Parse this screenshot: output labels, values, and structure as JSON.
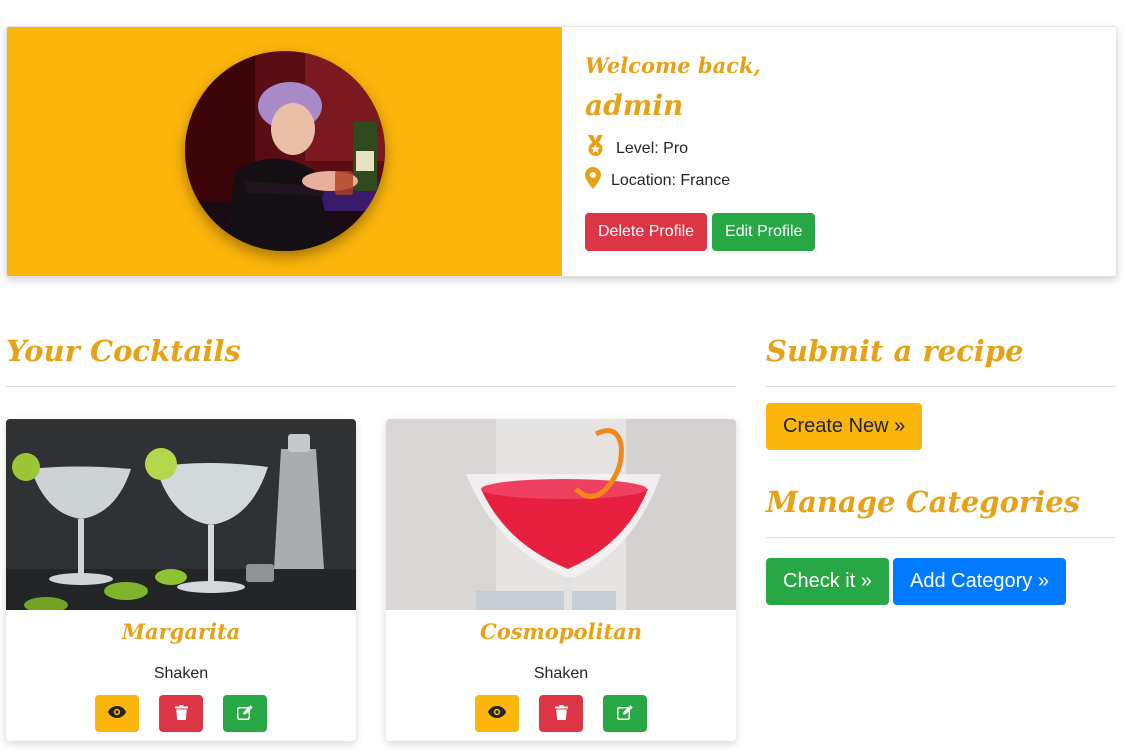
{
  "profile": {
    "welcome": "Welcome back,",
    "username": "admin",
    "level": "Level: Pro",
    "location": "Location: France",
    "delete_label": "Delete Profile",
    "edit_label": "Edit Profile"
  },
  "cocktails": {
    "title": "Your Cocktails",
    "items": [
      {
        "name": "Margarita",
        "method": "Shaken"
      },
      {
        "name": "Cosmopolitan",
        "method": "Shaken"
      }
    ]
  },
  "sidebar": {
    "submit_title": "Submit a recipe",
    "create_label": "Create New »",
    "manage_title": "Manage Categories",
    "check_label": "Check it »",
    "add_label": "Add Category »"
  },
  "icons": {
    "level": "medal-icon",
    "location": "map-marker-icon",
    "view": "eye-icon",
    "delete": "trash-icon",
    "edit": "edit-icon"
  },
  "colors": {
    "accent": "#fcb50a",
    "heading": "#e6a115",
    "danger": "#dc3545",
    "success": "#28a745",
    "primary": "#007bff"
  }
}
